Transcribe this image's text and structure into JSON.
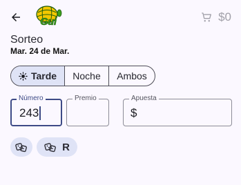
{
  "header": {
    "logo_text": "Gui",
    "cart_total": "$0"
  },
  "sorteo": {
    "title": "Sorteo",
    "date": "Mar. 24 de Mar."
  },
  "segments": [
    {
      "label": "Tarde",
      "icon": "sun-icon",
      "selected": true
    },
    {
      "label": "Noche",
      "selected": false
    },
    {
      "label": "Ambos",
      "selected": false
    }
  ],
  "fields": {
    "numero": {
      "label": "Número",
      "value": "243"
    },
    "premio": {
      "label": "Premio",
      "value": ""
    },
    "apuesta": {
      "label": "Apuesta",
      "prefix": "$",
      "value": ""
    }
  },
  "chips": [
    {
      "icon": "dice-icon",
      "label": ""
    },
    {
      "icon": "dice-icon",
      "label": "R"
    }
  ],
  "colors": {
    "background": "#fbf8ff",
    "accent": "#3d4a86",
    "selected_fill": "#dfe3f6",
    "logo_green": "#3da11d",
    "logo_yellow": "#f3c800"
  }
}
